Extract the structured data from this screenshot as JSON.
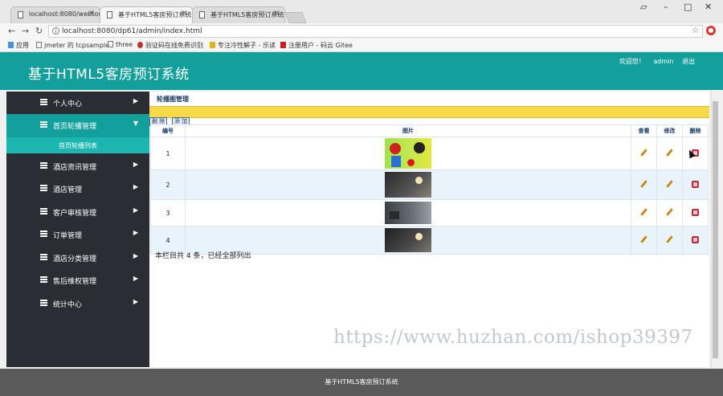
{
  "browser": {
    "tabs": [
      {
        "label": "localhost:8080/webtou"
      },
      {
        "label": "基于HTML5客房预订系统"
      },
      {
        "label": "基于HTML5客房预订系统"
      }
    ],
    "url": "localhost:8080/dp61/admin/index.html",
    "bookmarks": [
      "应用",
      "jmeter 的 tcpsample",
      "three",
      "验证码在线免费识别",
      "专注冷性解子 - 乐读",
      "注册用户 - 码云 Gitee"
    ]
  },
  "header": {
    "title": "基于HTML5客房预订系统",
    "welcome": "欢迎您！",
    "username": "admin",
    "logout": "退出"
  },
  "sidebar": {
    "items": [
      {
        "label": "个人中心"
      },
      {
        "label": "首页轮播管理"
      },
      {
        "label": "酒店资讯管理"
      },
      {
        "label": "酒店管理"
      },
      {
        "label": "客户审核管理"
      },
      {
        "label": "订单管理"
      },
      {
        "label": "酒店分类管理"
      },
      {
        "label": "售后维权管理"
      },
      {
        "label": "统计中心"
      }
    ],
    "subitem": "首页轮播列表"
  },
  "main": {
    "breadcrumb": "轮播图管理",
    "btn_delete": "删 除",
    "btn_add": "添 加",
    "columns": [
      "编号",
      "图片",
      "查看",
      "修改",
      "删除"
    ],
    "rows": [
      {
        "id": "1"
      },
      {
        "id": "2"
      },
      {
        "id": "3"
      },
      {
        "id": "4"
      }
    ],
    "summary": "本栏目共 4 条，已经全部列出"
  },
  "footer": "基于HTML5客房预订系统",
  "watermark": "https://www.huzhan.com/ishop39397",
  "colors": {
    "header": "#139f9b",
    "sidebar": "#2a2d33",
    "toolbar": "#f7d949",
    "footer": "#5a5a5a"
  }
}
